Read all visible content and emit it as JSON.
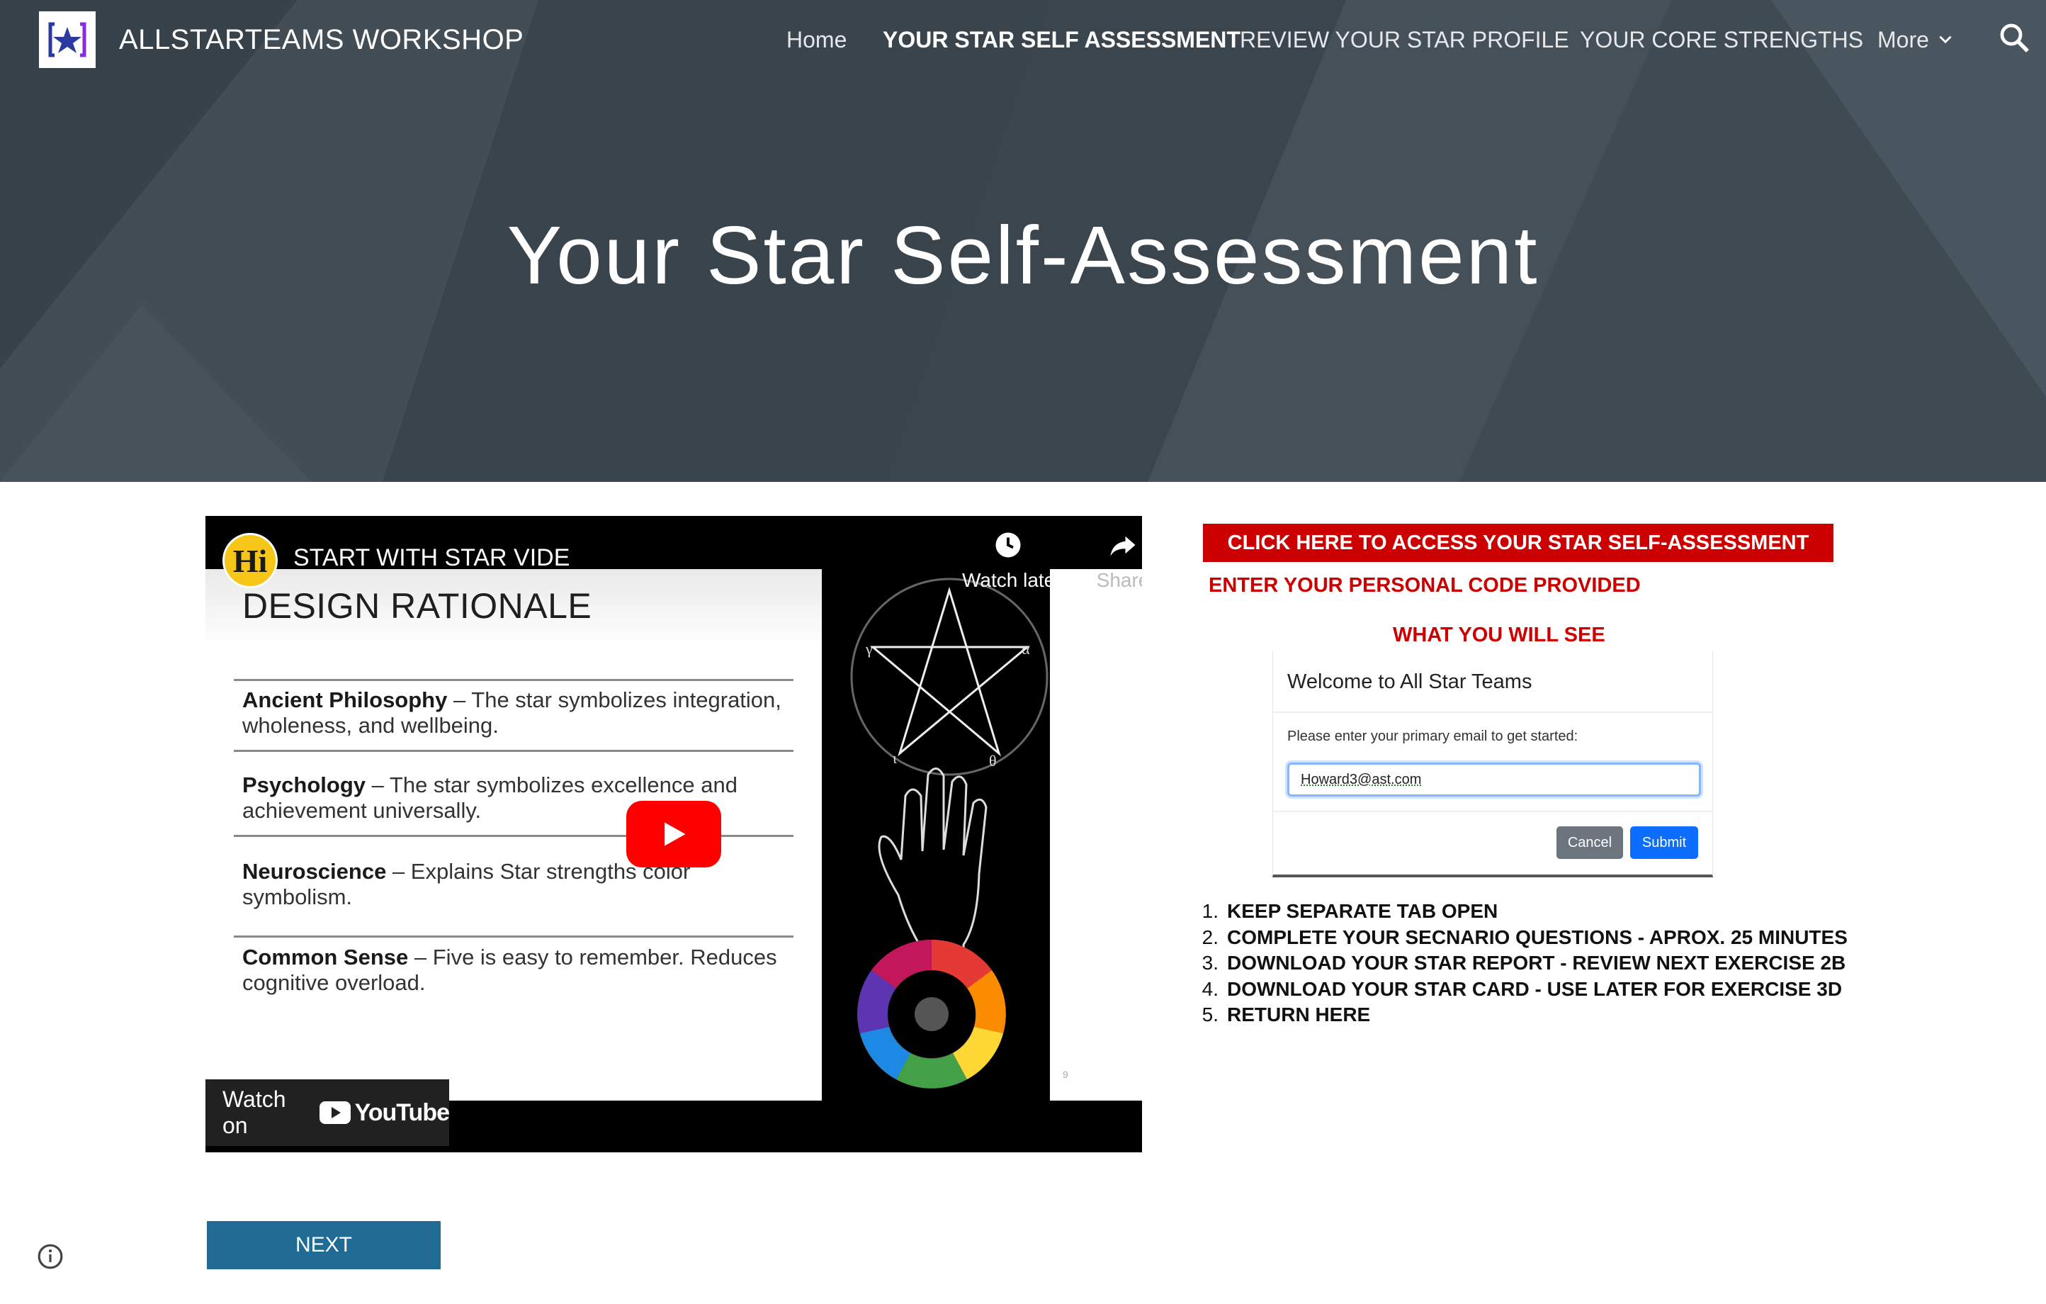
{
  "header": {
    "site_title": "ALLSTARTEAMS WORKSHOP",
    "nav": [
      {
        "label": "Home",
        "active": false
      },
      {
        "label": "YOUR STAR SELF ASSESSMENT",
        "active": true
      },
      {
        "label": "REVIEW YOUR STAR PROFILE",
        "active": false
      },
      {
        "label": "YOUR CORE STRENGTHS",
        "active": false
      },
      {
        "label": "More",
        "active": false
      }
    ],
    "icons": {
      "logo": "star-logo-icon",
      "more": "chevron-down-icon",
      "search": "search-icon"
    }
  },
  "hero": {
    "title": "Your Star Self-Assessment"
  },
  "video": {
    "channel_initials": "Hi",
    "title": "START WITH STAR VIDE",
    "watch_later_label": "Watch later",
    "share_label": "Share",
    "watch_on_label": "Watch on",
    "youtube_label": "YouTube",
    "slide": {
      "heading": "DESIGN RATIONALE",
      "items": [
        {
          "term": "Ancient Philosophy",
          "text": " – The star symbolizes integration, wholeness, and wellbeing."
        },
        {
          "term": "Psychology",
          "text": " – The star symbolizes excellence and achievement universally."
        },
        {
          "term": "Neuroscience",
          "text": " –  Explains Star strengths color symbolism."
        },
        {
          "term": "Common Sense",
          "text": " – Five is easy to remember. Reduces cognitive overload."
        }
      ],
      "page_number": "9",
      "pentagram_labels": [
        "γ",
        "α",
        "ι",
        "θ"
      ]
    }
  },
  "assessment": {
    "cta_label": "CLICK HERE TO ACCESS YOUR STAR SELF-ASSESSMENT",
    "code_instruction": "ENTER YOUR PERSONAL CODE PROVIDED",
    "preview_heading": "WHAT YOU WILL SEE",
    "preview": {
      "title": "Welcome to All Star Teams",
      "prompt": "Please enter your primary email to get started:",
      "email_value": "Howard3@ast.com",
      "cancel_label": "Cancel",
      "submit_label": "Submit"
    },
    "steps": [
      {
        "num": "1.",
        "text": "KEEP SEPARATE TAB OPEN"
      },
      {
        "num": "2.",
        "text": "COMPLETE YOUR SECNARIO QUESTIONS - APROX. 25 MINUTES"
      },
      {
        "num": "3.",
        "text": "DOWNLOAD YOUR STAR REPORT - REVIEW NEXT EXERCISE 2B"
      },
      {
        "num": "4.",
        "text": "DOWNLOAD YOUR STAR CARD - USE LATER FOR EXERCISE 3D"
      },
      {
        "num": "5.",
        "text": "RETURN HERE"
      }
    ]
  },
  "footer": {
    "next_label": "NEXT",
    "info_icon": "info-icon"
  },
  "colors": {
    "hero_bg": "#3b454d",
    "accent_red": "#cc0000",
    "next_button": "#1f6b94",
    "submit_blue": "#0d6efd",
    "cancel_gray": "#6c757d",
    "youtube_red": "#ff0000"
  }
}
